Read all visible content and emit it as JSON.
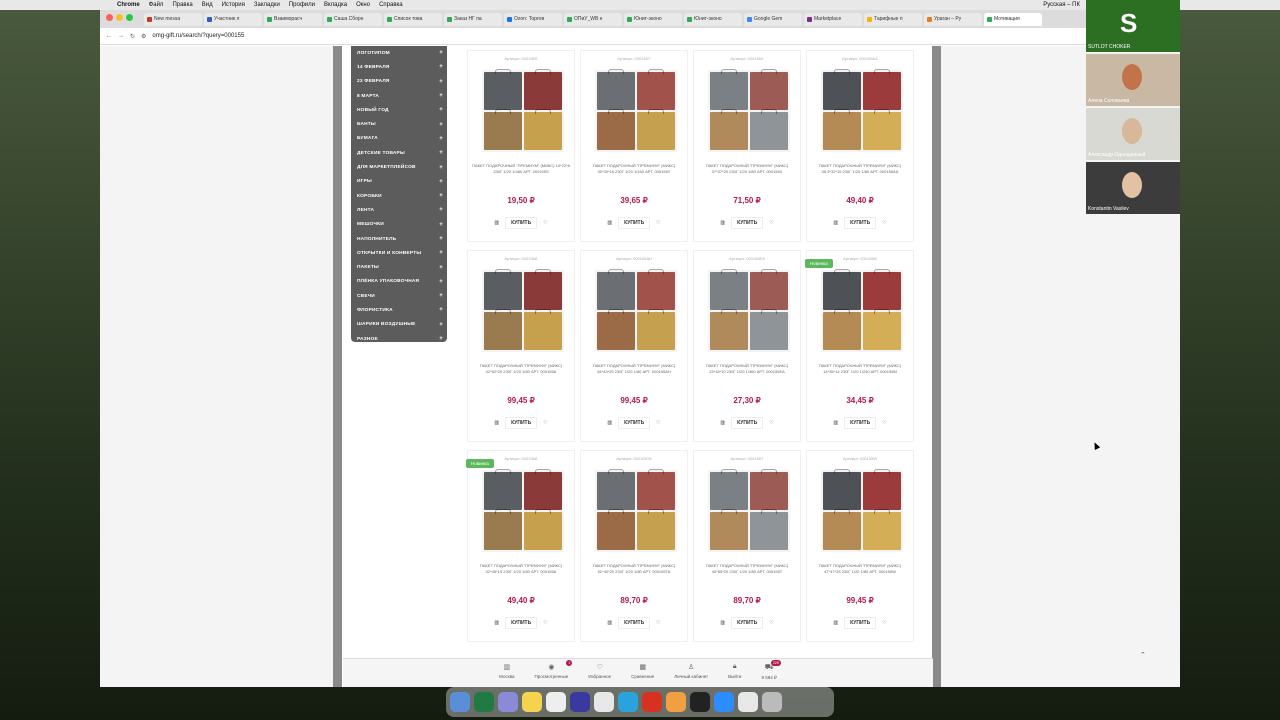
{
  "menubar": {
    "items": [
      "Chrome",
      "Файл",
      "Правка",
      "Вид",
      "История",
      "Закладки",
      "Профили",
      "Вкладка",
      "Окно",
      "Справка"
    ],
    "right": "Русская – ПК"
  },
  "tabs": [
    {
      "label": "New messa",
      "color": "#c0392b"
    },
    {
      "label": "Участник л",
      "color": "#2e5cb8"
    },
    {
      "label": "Взаимораcч",
      "color": "#34a853"
    },
    {
      "label": "Саша Сборн",
      "color": "#34a853"
    },
    {
      "label": "Список това",
      "color": "#34a853"
    },
    {
      "label": "Заказ НГ па",
      "color": "#34a853"
    },
    {
      "label": "Ozon: Торгов",
      "color": "#1a73e8"
    },
    {
      "label": "ОПиУ_WB н",
      "color": "#34a853"
    },
    {
      "label": "Юнит-эконо",
      "color": "#34a853"
    },
    {
      "label": "Юнит-эконо",
      "color": "#34a853"
    },
    {
      "label": "Google Gem",
      "color": "#4285f4"
    },
    {
      "label": "Marketplace",
      "color": "#7b2d8e"
    },
    {
      "label": "Тарифные п",
      "color": "#f4b400"
    },
    {
      "label": "Ураган – Ру",
      "color": "#e67e22"
    },
    {
      "label": "Мотивация",
      "color": "#34a853"
    }
  ],
  "url": "omg-gift.ru/search/?query=000155",
  "sidebar": [
    "ЛОГОТИПОМ",
    "14 ФЕВРАЛЯ",
    "23 ФЕВРАЛЯ",
    "8 МАРТА",
    "НОВЫЙ ГОД",
    "БАНТЫ",
    "БУМАГА",
    "ДЕТСКИЕ ТОВАРЫ",
    "ДЛЯ МАРКЕТПЛЕЙСОВ",
    "ИГРЫ",
    "КОРОБКИ",
    "ЛЕНТА",
    "МЕШОЧКИ",
    "НАПОЛНИТЕЛЬ",
    "ОТКРЫТКИ И КОНВЕРТЫ",
    "ПАКЕТЫ",
    "ПЛЁНКА УПАКОВОЧНАЯ",
    "СВЕЧИ",
    "ФЛОРИСТИКА",
    "ШАРИКИ ВОЗДУШНЫЕ",
    "РАЗНОЕ"
  ],
  "sidebar_plus": "+",
  "products": [
    {
      "art": "Артикул: 000155S",
      "name": "ПАКЕТ ПОДАРОЧНЫЙ \"ПРЕМИУМ\" (МИКС) 10*22*6 230Г 1/20 1/480 АРТ. 000155S",
      "price": "19,50 ₽",
      "badge": ""
    },
    {
      "art": "Артикул: 000155Y",
      "name": "ПАКЕТ ПОДАРОЧНЫЙ \"ПРЕМИУМ\" (МИКС) 30*30*16 230Г 1/20 1/160 АРТ. 000155Y",
      "price": "39,65 ₽",
      "badge": ""
    },
    {
      "art": "Артикул: 000155X",
      "name": "ПАКЕТ ПОДАРОЧНЫЙ \"ПРЕМИУМ\" (МИКС) 37*37*20 230Г 1/20 1/80 АРТ. 000155X",
      "price": "71,50 ₽",
      "badge": ""
    },
    {
      "art": "Артикул: 000155AA",
      "name": "ПАКЕТ ПОДАРОЧНЫЙ \"ПРЕМИУМ\" (МИКС) 36,5*32*15 230Г 1/20 1/80 АРТ. 000155AA",
      "price": "49,40 ₽",
      "badge": ""
    },
    {
      "art": "Артикул: 000155A",
      "name": "ПАКЕТ ПОДАРОЧНЫЙ \"ПРЕМИУМ\" (МИКС) 42*62*20 230Г 1/20 1/80 АРТ. 000155A",
      "price": "99,45 ₽",
      "badge": ""
    },
    {
      "art": "Артикул: 000155AH",
      "name": "ПАКЕТ ПОДАРОЧНЫЙ \"ПРЕМИУМ\" (МИКС) 64*43*25 230Г 1/20 1/80 АРТ. 000155AH",
      "price": "99,45 ₽",
      "badge": ""
    },
    {
      "art": "Артикул: 000155EA",
      "name": "ПАКЕТ ПОДАРОЧНЫЙ \"ПРЕМИУМ\" (МИКС) 23*18*10 230Г 1/20 1/360 АРТ. 000155EA",
      "price": "27,30 ₽",
      "badge": ""
    },
    {
      "art": "Артикул: 000155M",
      "name": "ПАКЕТ ПОДАРОЧНЫЙ \"ПРЕМИУМ\" (МИКС) 14*35*14 230Г 1/20 1/240 АРТ. 000155M",
      "price": "34,45 ₽",
      "badge": "Новинка"
    },
    {
      "art": "Артикул: 000155A",
      "name": "ПАКЕТ ПОДАРОЧНЫЙ \"ПРЕМИУМ\" (МИКС) 32*45*15 230Г 1/20 1/80 АРТ. 000155A",
      "price": "49,40 ₽",
      "badge": "Новинка"
    },
    {
      "art": "Артикул: 000155TA",
      "name": "ПАКЕТ ПОДАРОЧНЫЙ \"ПРЕМИУМ\" (МИКС) 51*40*20 230Г 1/20 1/80 АРТ. 000155TA",
      "price": "89,70 ₽",
      "badge": ""
    },
    {
      "art": "Артикул: 000155T",
      "name": "ПАКЕТ ПОДАРОЧНЫЙ \"ПРЕМИУМ\" (МИКС) 40*55*20 230Г 1/20 1/80 АРТ. 000155T",
      "price": "89,70 ₽",
      "badge": ""
    },
    {
      "art": "Артикул: 000155W",
      "name": "ПАКЕТ ПОДАРОЧНЫЙ \"ПРЕМИУМ\" (МИКС) 47*47*25 230Г 1/20 1/80 АРТ. 000155W",
      "price": "99,45 ₽",
      "badge": ""
    }
  ],
  "buy_label": "КУПИТЬ",
  "bottom_nav": [
    {
      "label": "Москва",
      "icon": "building-icon",
      "count": ""
    },
    {
      "label": "Просмотренные",
      "icon": "eye-icon",
      "count": "1"
    },
    {
      "label": "Избранное",
      "icon": "heart-icon",
      "count": ""
    },
    {
      "label": "Сравнение",
      "icon": "compare-icon",
      "count": ""
    },
    {
      "label": "Личный кабинет",
      "icon": "user-icon",
      "count": ""
    },
    {
      "label": "Выйти",
      "icon": "lock-icon",
      "count": ""
    },
    {
      "label": "9 594 ₽",
      "icon": "cart-icon",
      "count": "225"
    }
  ],
  "video": [
    {
      "label": "SUTLOT CHOKER",
      "initial": "S"
    },
    {
      "label": "Алена Соловьева"
    },
    {
      "label": "Александр Однощевный"
    },
    {
      "label": "Konstantin Vasilev"
    }
  ],
  "dock": [
    "Finder",
    "Excel",
    "Launchpad",
    "Notes",
    "Reminders",
    "Affinity",
    "Chrome",
    "Telegram",
    "Acrobat",
    "Photos",
    "V2",
    "Zoom",
    "Slack",
    "Trash"
  ],
  "colors": {
    "price": "#b3174f",
    "badge": "#5cb85c",
    "sidebar": "#5c5c5c"
  }
}
